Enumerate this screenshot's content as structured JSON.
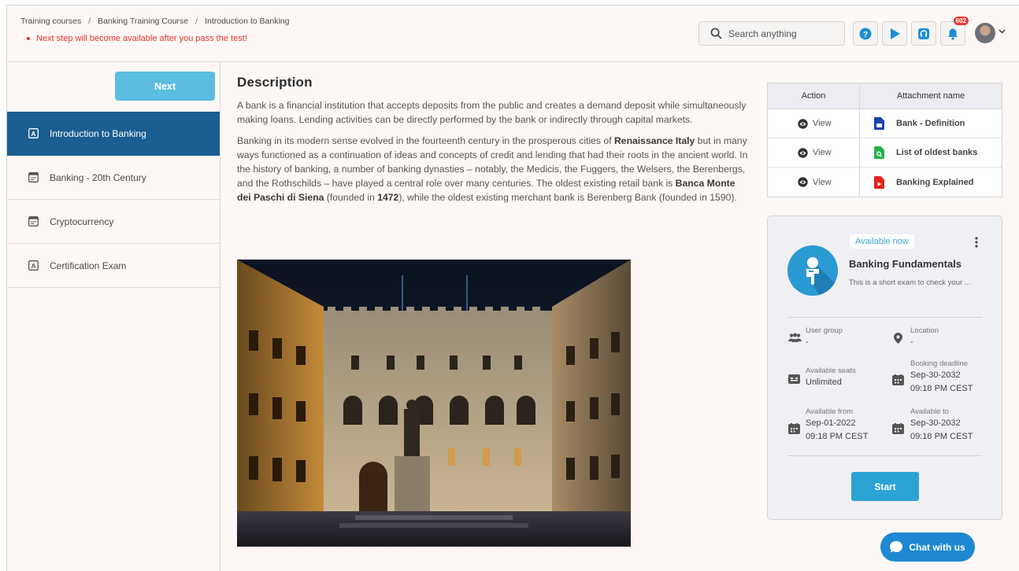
{
  "breadcrumb": [
    "Training courses",
    "Banking Training Course",
    "Introduction to Banking"
  ],
  "notice": "Next step will become available after you pass the test!",
  "search": {
    "placeholder": "Search anything"
  },
  "notifications": {
    "count": "602"
  },
  "sidebar": {
    "next_label": "Next",
    "items": [
      {
        "label": "Introduction to Banking",
        "icon": "text-box-icon",
        "active": true
      },
      {
        "label": "Banking - 20th Century",
        "icon": "window-icon",
        "active": false
      },
      {
        "label": "Cryptocurrency",
        "icon": "window-icon",
        "active": false
      },
      {
        "label": "Certification Exam",
        "icon": "text-box-icon",
        "active": false
      }
    ]
  },
  "content": {
    "heading": "Description",
    "p1": "A bank is a financial institution that accepts deposits from the public and creates a demand deposit while simultaneously making loans. Lending activities can be directly performed by the bank or indirectly through capital markets.",
    "p2_a": "Banking in its modern sense evolved in the fourteenth century in the prosperous cities of ",
    "p2_b": "Renaissance Italy",
    "p2_c": " but in many ways functioned as a continuation of ideas and concepts of credit and lending that had their roots in the ancient world. In the history of banking, a number of banking dynasties – notably, the Medicis, the Fuggers, the Welsers, the Berenbergs, and the Rothschilds – have played a central role over many centuries. The oldest existing retail bank is ",
    "p2_d": "Banca Monte dei Paschi di Siena",
    "p2_e": " (founded in ",
    "p2_f": "1472",
    "p2_g": "), while the oldest existing merchant bank is Berenberg Bank (founded in 1590)."
  },
  "attachments": {
    "headers": {
      "action": "Action",
      "name": "Attachment name"
    },
    "rows": [
      {
        "action": "View",
        "name": "Bank - Definition",
        "color": "#1a3fb5"
      },
      {
        "action": "View",
        "name": "List of oldest banks",
        "color": "#25b24a"
      },
      {
        "action": "View",
        "name": "Banking Explained",
        "color": "#e5231b"
      }
    ]
  },
  "exam": {
    "status": "Available now",
    "title": "Banking Fundamentals",
    "description": "This is a short exam to check your ...",
    "user_group_label": "User group",
    "user_group_value": "-",
    "location_label": "Location",
    "location_value": "-",
    "seats_label": "Available seats",
    "seats_value": "Unlimited",
    "deadline_label": "Booking deadline",
    "deadline_date": "Sep-30-2032",
    "deadline_time": "09:18 PM CEST",
    "from_label": "Available from",
    "from_date": "Sep-01-2022",
    "from_time": "09:18 PM CEST",
    "to_label": "Available to",
    "to_date": "Sep-30-2032",
    "to_time": "09:18 PM CEST",
    "start_label": "Start"
  },
  "chat": {
    "label": "Chat with us"
  },
  "colors": {
    "accent": "#1a5e92",
    "button": "#2ba3d5",
    "alert": "#e0362c"
  }
}
